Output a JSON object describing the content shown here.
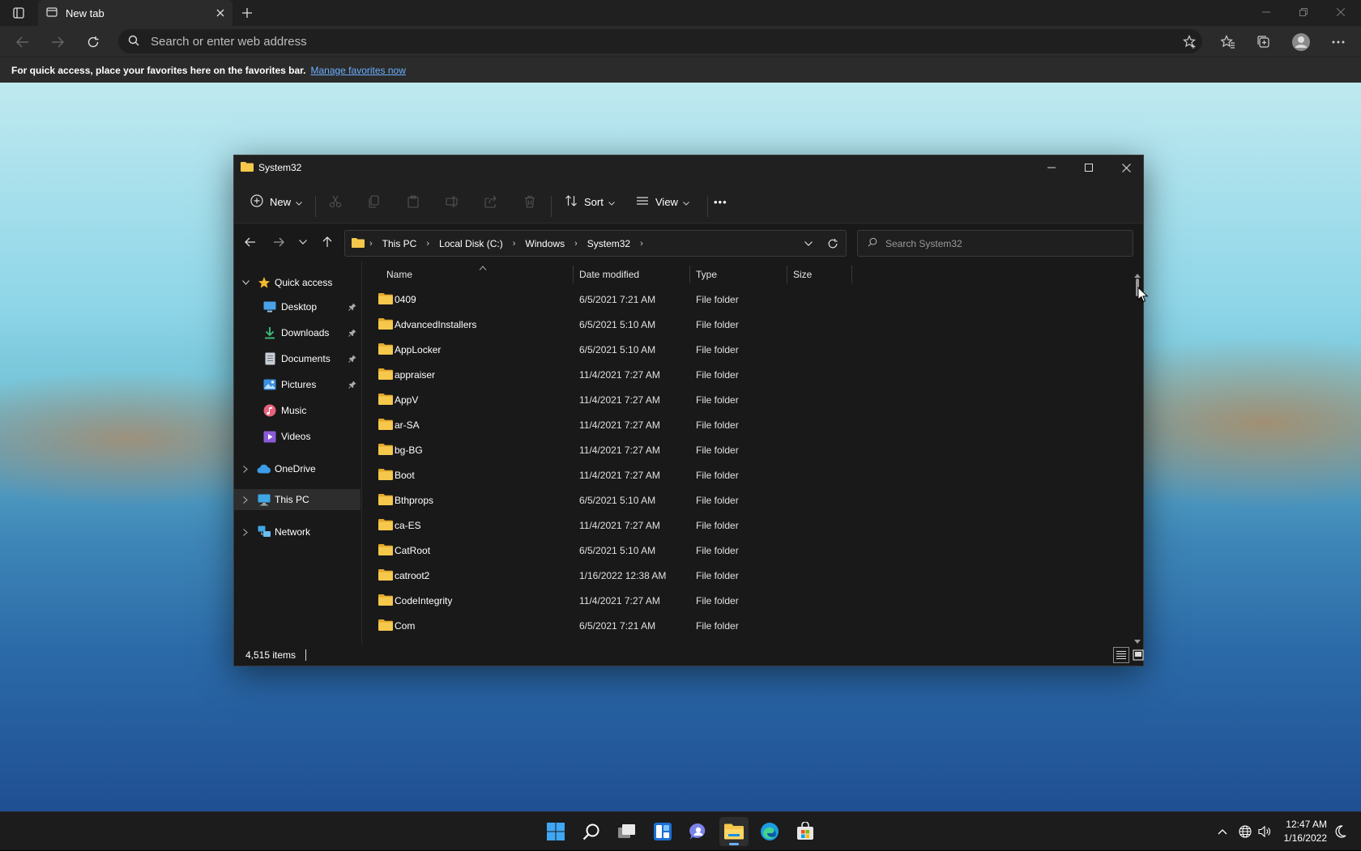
{
  "browser": {
    "tab_title": "New tab",
    "address_placeholder": "Search or enter web address",
    "favorites_message": "For quick access, place your favorites here on the favorites bar.",
    "favorites_link": "Manage favorites now"
  },
  "explorer": {
    "title": "System32",
    "commands": {
      "new": "New",
      "sort": "Sort",
      "view": "View",
      "more": "•••"
    },
    "breadcrumb": [
      "This PC",
      "Local Disk (C:)",
      "Windows",
      "System32"
    ],
    "search_placeholder": "Search System32",
    "nav": {
      "quick_access": "Quick access",
      "items": [
        {
          "label": "Desktop",
          "pinned": true
        },
        {
          "label": "Downloads",
          "pinned": true
        },
        {
          "label": "Documents",
          "pinned": true
        },
        {
          "label": "Pictures",
          "pinned": true
        },
        {
          "label": "Music",
          "pinned": false
        },
        {
          "label": "Videos",
          "pinned": false
        }
      ],
      "onedrive": "OneDrive",
      "this_pc": "This PC",
      "network": "Network"
    },
    "columns": {
      "name": "Name",
      "date": "Date modified",
      "type": "Type",
      "size": "Size"
    },
    "rows": [
      {
        "name": "0409",
        "date": "6/5/2021 7:21 AM",
        "type": "File folder"
      },
      {
        "name": "AdvancedInstallers",
        "date": "6/5/2021 5:10 AM",
        "type": "File folder"
      },
      {
        "name": "AppLocker",
        "date": "6/5/2021 5:10 AM",
        "type": "File folder"
      },
      {
        "name": "appraiser",
        "date": "11/4/2021 7:27 AM",
        "type": "File folder"
      },
      {
        "name": "AppV",
        "date": "11/4/2021 7:27 AM",
        "type": "File folder"
      },
      {
        "name": "ar-SA",
        "date": "11/4/2021 7:27 AM",
        "type": "File folder"
      },
      {
        "name": "bg-BG",
        "date": "11/4/2021 7:27 AM",
        "type": "File folder"
      },
      {
        "name": "Boot",
        "date": "11/4/2021 7:27 AM",
        "type": "File folder"
      },
      {
        "name": "Bthprops",
        "date": "6/5/2021 5:10 AM",
        "type": "File folder"
      },
      {
        "name": "ca-ES",
        "date": "11/4/2021 7:27 AM",
        "type": "File folder"
      },
      {
        "name": "CatRoot",
        "date": "6/5/2021 5:10 AM",
        "type": "File folder"
      },
      {
        "name": "catroot2",
        "date": "1/16/2022 12:38 AM",
        "type": "File folder"
      },
      {
        "name": "CodeIntegrity",
        "date": "11/4/2021 7:27 AM",
        "type": "File folder"
      },
      {
        "name": "Com",
        "date": "6/5/2021 7:21 AM",
        "type": "File folder"
      }
    ],
    "status": "4,515 items"
  },
  "taskbar": {
    "time": "12:47 AM",
    "date": "1/16/2022"
  },
  "colors": {
    "accent": "#6ab0ff",
    "folder": "#f5c84c",
    "window_bg": "#191919"
  }
}
